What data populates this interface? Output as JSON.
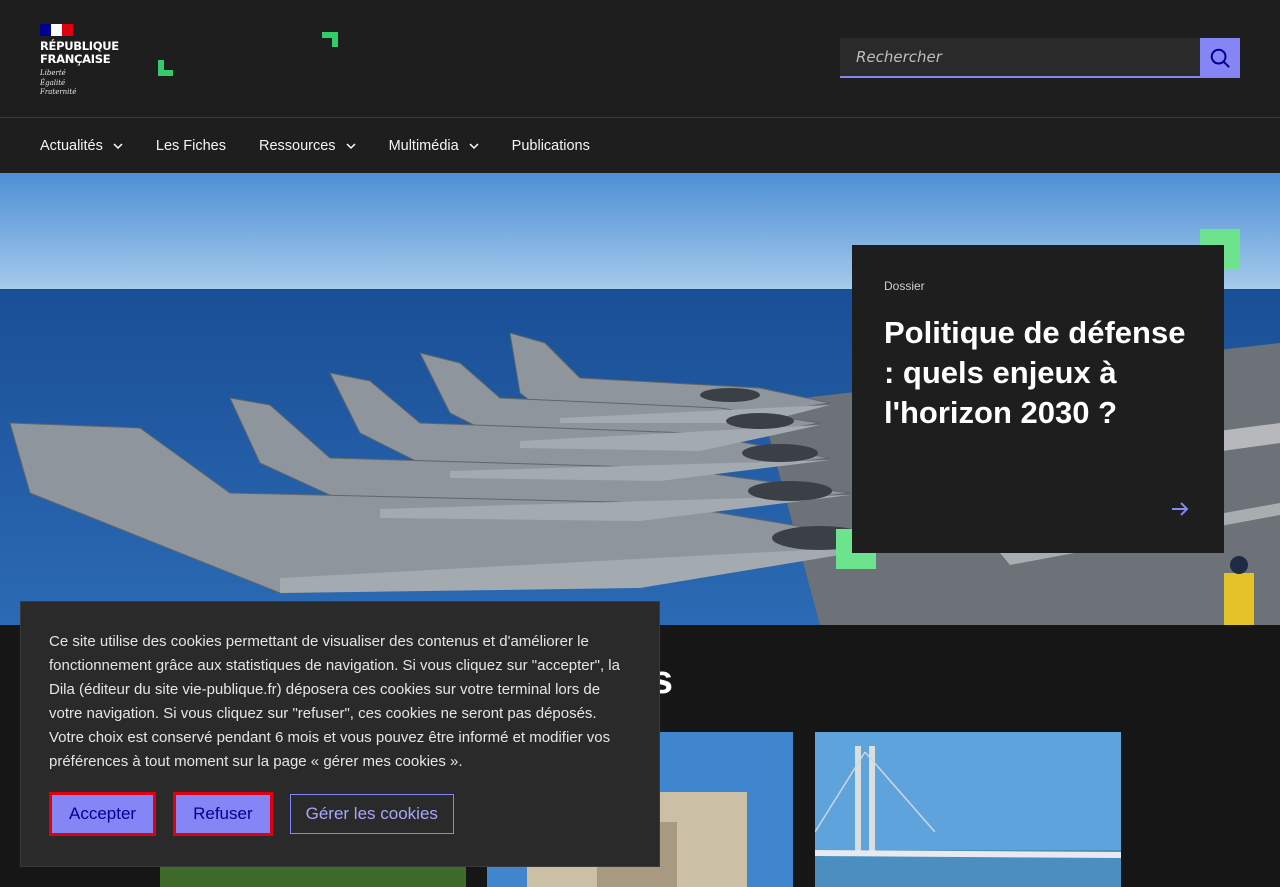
{
  "header": {
    "gov_title_line1": "RÉPUBLIQUE",
    "gov_title_line2": "FRANÇAISE",
    "devise_line1": "Liberté",
    "devise_line2": "Égalité",
    "devise_line3": "Fraternité",
    "search_placeholder": "Rechercher",
    "search_icon": "search-icon"
  },
  "nav": {
    "items": [
      {
        "label": "Actualités",
        "has_dropdown": true
      },
      {
        "label": "Les Fiches",
        "has_dropdown": false
      },
      {
        "label": "Ressources",
        "has_dropdown": true
      },
      {
        "label": "Multimédia",
        "has_dropdown": true
      },
      {
        "label": "Publications",
        "has_dropdown": false
      }
    ]
  },
  "hero": {
    "tag": "Dossier",
    "title": "Politique de défense : quels enjeux à l'horizon 2030 ?",
    "arrow_icon": "arrow-right-icon"
  },
  "section": {
    "title_visible": "lités"
  },
  "cookie": {
    "text": "Ce site utilise des cookies permettant de visualiser des contenus et d'améliorer le fonctionnement grâce aux statistiques de navigation. Si vous cliquez sur \"accepter\", la Dila (éditeur du site vie-publique.fr) déposera ces cookies sur votre terminal lors de votre navigation. Si vous cliquez sur \"refuser\", ces cookies ne seront pas déposés. Votre choix est conservé pendant 6 mois et vous pouvez être informé et modifier vos préférences à tout moment sur la page « gérer mes cookies ».",
    "accept_label": "Accepter",
    "refuse_label": "Refuser",
    "manage_label": "Gérer les cookies"
  },
  "colors": {
    "accent": "#8585f6",
    "accent_text": "#000091",
    "brand_green": "#34cb6a",
    "focus_red": "#e1000f",
    "background": "#1e1e1e"
  }
}
